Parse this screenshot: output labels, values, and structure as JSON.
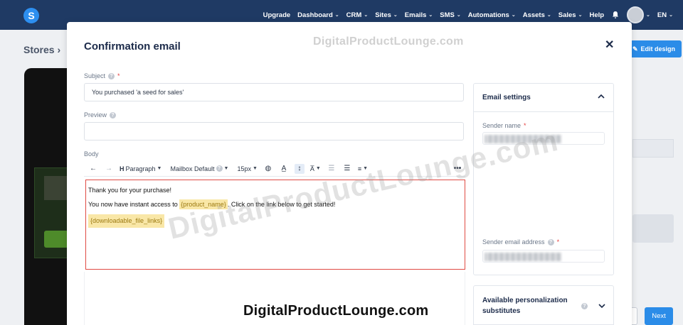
{
  "nav": {
    "logo": "S",
    "items": [
      "Upgrade",
      "Dashboard",
      "CRM",
      "Sites",
      "Emails",
      "SMS",
      "Automations",
      "Assets",
      "Sales",
      "Help"
    ],
    "dropdown_items": [
      false,
      true,
      true,
      true,
      true,
      true,
      true,
      true,
      true,
      false
    ],
    "language": "EN"
  },
  "page": {
    "breadcrumb": "Stores",
    "edit_design": "Edit design",
    "next": "Next"
  },
  "modal": {
    "title": "Confirmation email",
    "subject_label": "Subject",
    "subject_value": "You purchased 'a seed for sales'",
    "preview_label": "Preview",
    "preview_value": "",
    "body_label": "Body"
  },
  "toolbar": {
    "paragraph": "Paragraph",
    "font": "Mailbox Default",
    "size": "15px"
  },
  "editor": {
    "line1": "Thank you for your purchase!",
    "line2_before": "You now have instant access to ",
    "line2_tag": "{product_name}",
    "line2_after": ". Click on the link below to get started!",
    "line3_tag": "{downloadable_file_links}"
  },
  "settings": {
    "title": "Email settings",
    "sender_name_label": "Sender name",
    "sender_email_label": "Sender email address",
    "personalization_title": "Available personalization substitutes"
  },
  "watermark": {
    "text": "DigitalProductLounge.com"
  },
  "colors": {
    "nav_bg": "#1f3a64",
    "accent": "#2b8ce8",
    "highlight_border": "#e04a43",
    "tag_bg": "#f9e7a7"
  }
}
